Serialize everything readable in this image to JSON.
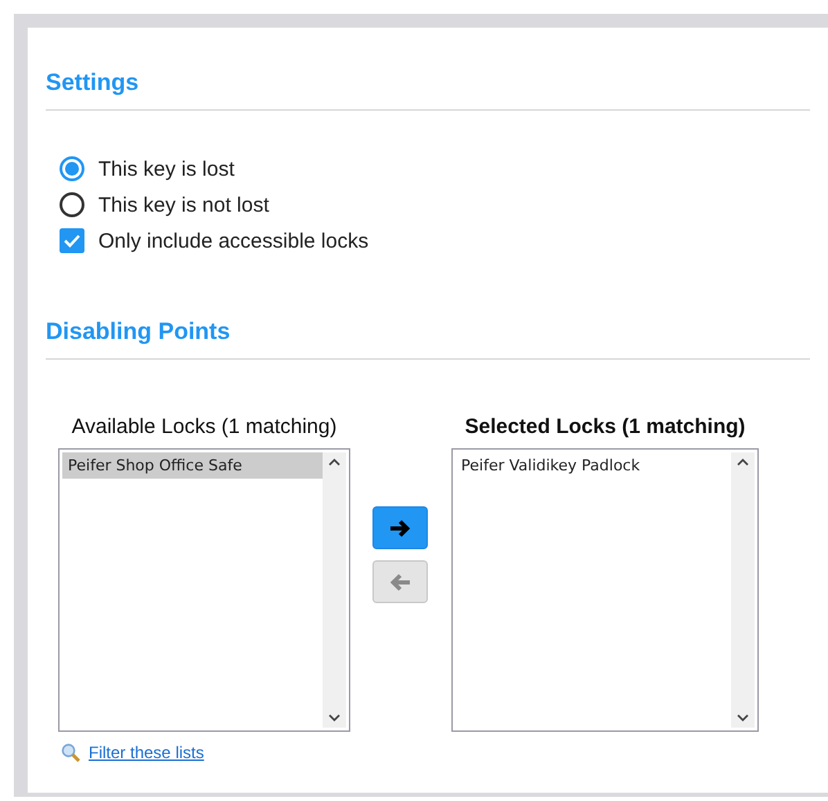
{
  "settings": {
    "title": "Settings",
    "options": [
      {
        "kind": "radio",
        "label": "This key is lost",
        "checked": true
      },
      {
        "kind": "radio",
        "label": "This key is not lost",
        "checked": false
      },
      {
        "kind": "checkbox",
        "label": "Only include accessible locks",
        "checked": true
      }
    ]
  },
  "disabling_points": {
    "title": "Disabling Points",
    "lists": [
      {
        "label": "Available Locks (1 matching)",
        "active": false,
        "items": [
          {
            "label": "Peifer Shop Office Safe",
            "selected": true
          }
        ]
      },
      {
        "label": "Selected Locks (1 matching)",
        "active": true,
        "items": [
          {
            "label": "Peifer Validikey Padlock",
            "selected": false
          }
        ]
      }
    ],
    "move_buttons": [
      {
        "kind": "add",
        "disabled": false
      },
      {
        "kind": "remove",
        "disabled": true
      }
    ],
    "filter_link": "Filter these lists"
  }
}
